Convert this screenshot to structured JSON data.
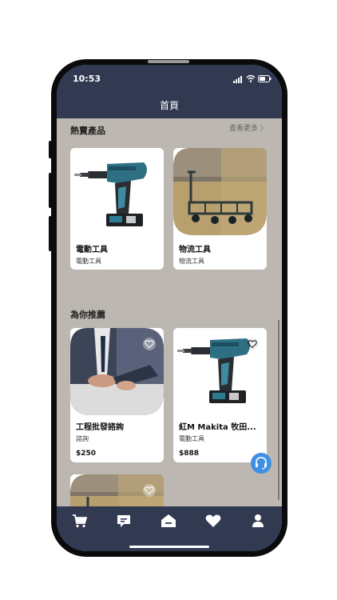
{
  "status_bar": {
    "time": "10:53",
    "signal_icon": "signal-bars-icon",
    "wifi_icon": "wifi-icon",
    "battery_icon": "battery-icon"
  },
  "header": {
    "title": "首頁"
  },
  "hot_products": {
    "title": "熱賣產品",
    "see_more": "查看更多 〉",
    "items": [
      {
        "title": "電動工具",
        "subtitle": "電動工具",
        "image": "cordless-drill-image"
      },
      {
        "title": "物流工具",
        "subtitle": "物流工具",
        "image": "platform-cart-image"
      }
    ]
  },
  "recommended": {
    "title": "為你推薦",
    "items": [
      {
        "title": "工程批發諮詢",
        "subtitle": "諮詢",
        "price": "$250",
        "image": "business-consult-image",
        "fav_icon": "heart-outline-icon"
      },
      {
        "title": "紅M Makita 牧田...",
        "subtitle": "電動工具",
        "price": "$888",
        "image": "cordless-drill-image",
        "fav_icon": "heart-outline-icon"
      },
      {
        "image": "platform-cart-image",
        "fav_icon": "heart-outline-icon"
      }
    ]
  },
  "help_button": {
    "icon": "headset-icon"
  },
  "tab_bar": {
    "tabs": [
      {
        "icon": "cart-icon"
      },
      {
        "icon": "message-icon"
      },
      {
        "icon": "home-icon",
        "active": true
      },
      {
        "icon": "heart-icon"
      },
      {
        "icon": "user-icon"
      }
    ]
  },
  "colors": {
    "bar_bg": "#323a52",
    "content_bg": "#bcb8b1",
    "accent": "#3f8fe6"
  }
}
